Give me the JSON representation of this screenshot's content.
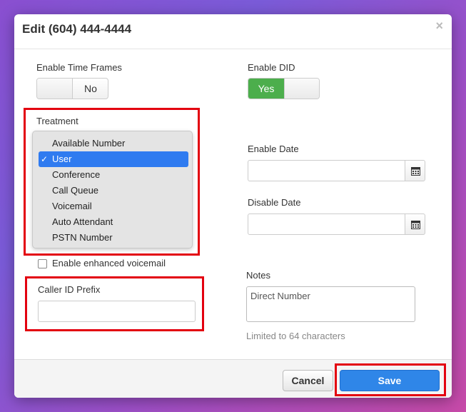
{
  "modal": {
    "title": "Edit (604) 444-4444",
    "close_glyph": "×"
  },
  "time_frames": {
    "label": "Enable Time Frames",
    "value": "No"
  },
  "did": {
    "label": "Enable DID",
    "value": "Yes"
  },
  "treatment": {
    "label": "Treatment",
    "options": [
      "Available Number",
      "User",
      "Conference",
      "Call Queue",
      "Voicemail",
      "Auto Attendant",
      "PSTN Number"
    ],
    "selected": "User",
    "check_glyph": "✓"
  },
  "enable_date": {
    "label": "Enable Date",
    "value": ""
  },
  "disable_date": {
    "label": "Disable Date",
    "value": ""
  },
  "enhanced_voicemail": {
    "label": "Enable enhanced voicemail",
    "checked": false
  },
  "caller_id_prefix": {
    "label": "Caller ID Prefix",
    "value": ""
  },
  "notes": {
    "label": "Notes",
    "value": "Direct Number",
    "hint": "Limited to 64 characters"
  },
  "footer": {
    "cancel_label": "Cancel",
    "save_label": "Save"
  },
  "colors": {
    "accent_blue": "#2f86e8",
    "toggle_green": "#4cae4c",
    "highlight_red": "#e3000f"
  },
  "icons": {
    "calendar": "calendar-icon",
    "close": "close-icon",
    "check": "checkmark-icon"
  }
}
